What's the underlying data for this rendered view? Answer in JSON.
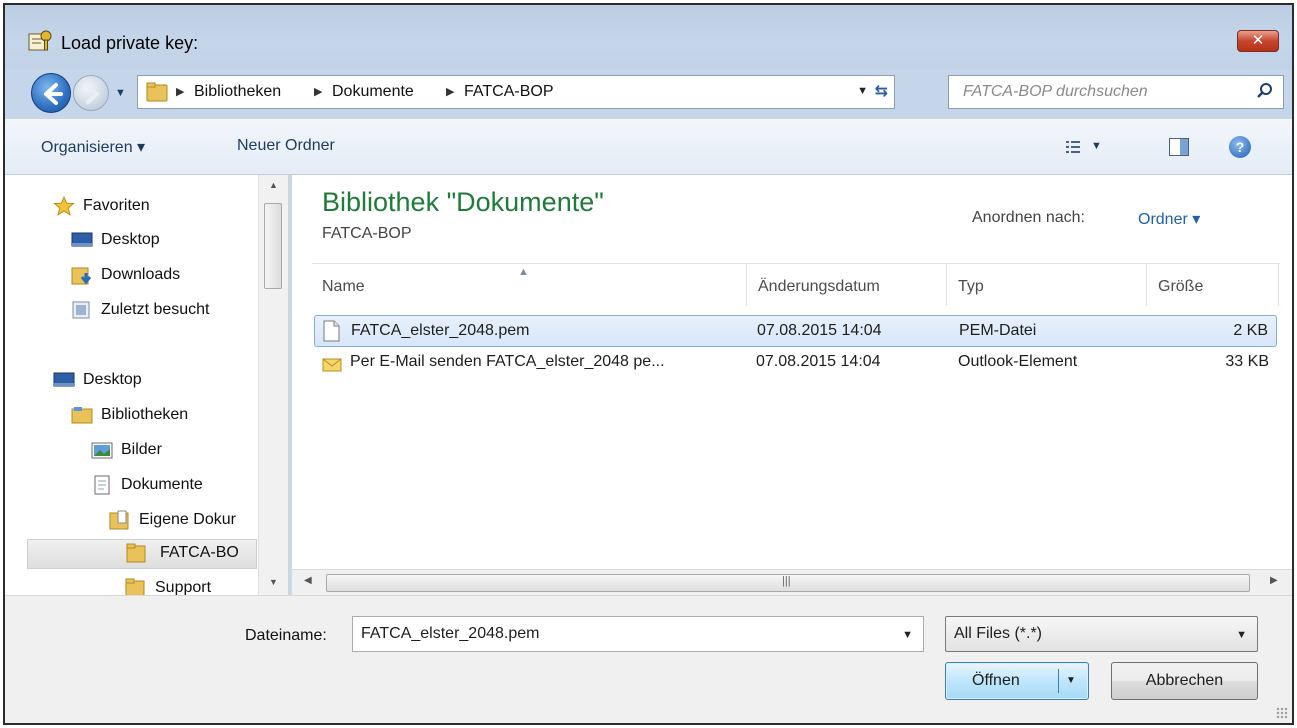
{
  "window": {
    "title": "Load private key:",
    "close_label": "✕"
  },
  "nav": {
    "breadcrumbs": [
      "Bibliotheken",
      "Dokumente",
      "FATCA-BOP"
    ],
    "search_placeholder": "FATCA-BOP durchsuchen"
  },
  "toolbar": {
    "organize_label": "Organisieren ▾",
    "new_folder_label": "Neuer Ordner",
    "help_label": "?"
  },
  "sidebar": {
    "items": [
      {
        "label": "Favoriten",
        "icon": "star-icon"
      },
      {
        "label": "Desktop",
        "icon": "desktop-icon"
      },
      {
        "label": "Downloads",
        "icon": "downloads-folder-icon"
      },
      {
        "label": "Zuletzt besucht",
        "icon": "recent-places-icon"
      },
      {
        "label": "Desktop",
        "icon": "desktop-icon"
      },
      {
        "label": "Bibliotheken",
        "icon": "libraries-icon"
      },
      {
        "label": "Bilder",
        "icon": "pictures-icon"
      },
      {
        "label": "Dokumente",
        "icon": "documents-icon"
      },
      {
        "label": "Eigene Dokur",
        "icon": "folder-doc-icon"
      },
      {
        "label": "FATCA-BO",
        "icon": "folder-icon"
      },
      {
        "label": "Support",
        "icon": "folder-icon"
      }
    ],
    "selected": "FATCA-BO"
  },
  "library": {
    "title": "Bibliothek \"Dokumente\"",
    "subtitle": "FATCA-BOP",
    "arrange_label": "Anordnen nach:",
    "arrange_value": "Ordner ▾"
  },
  "columns": [
    "Name",
    "Änderungsdatum",
    "Typ",
    "Größe"
  ],
  "files": [
    {
      "name": "FATCA_elster_2048.pem",
      "date": "07.08.2015 14:04",
      "type": "PEM-Datei",
      "size": "2 KB",
      "icon": "file-icon"
    },
    {
      "name": "Per E-Mail senden  FATCA_elster_2048 pe...",
      "date": "07.08.2015 14:04",
      "type": "Outlook-Element",
      "size": "33 KB",
      "icon": "envelope-icon"
    }
  ],
  "footer": {
    "filename_label": "Dateiname:",
    "filename_value": "FATCA_elster_2048.pem",
    "filetype_value": "All Files (*.*)",
    "open_label": "Öffnen",
    "cancel_label": "Abbrechen"
  },
  "colors": {
    "title_green": "#1e7b3a",
    "link_blue": "#1f5fb0",
    "selection": "#d6e6f9"
  }
}
